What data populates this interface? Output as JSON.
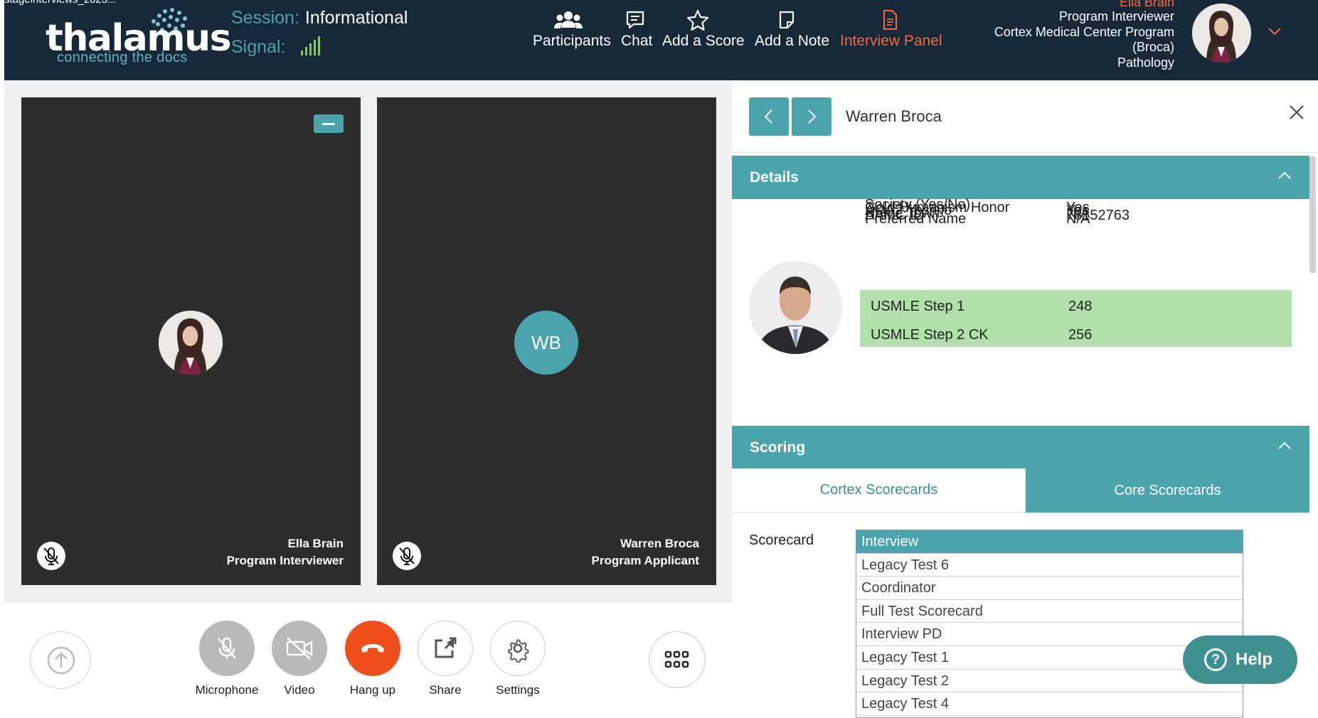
{
  "header": {
    "top_fragment": "stageinterviews_2023...",
    "logo": {
      "word": "thalamus",
      "tagline": "connecting the docs"
    },
    "session_label": "Session:",
    "session_value": "Informational",
    "signal_label": "Signal:",
    "signal_bars": 5,
    "nav": [
      {
        "label": "Participants",
        "icon": "participants-icon"
      },
      {
        "label": "Chat",
        "icon": "chat-icon"
      },
      {
        "label": "Add a Score",
        "icon": "star-icon"
      },
      {
        "label": "Add a Note",
        "icon": "note-icon"
      },
      {
        "label": "Interview Panel",
        "icon": "document-icon",
        "active": true
      }
    ],
    "user": {
      "name": "Ella Brain",
      "role": "Program Interviewer",
      "program_line1": "Cortex Medical Center Program",
      "program_line2": "(Broca)",
      "program_line3": "Pathology"
    }
  },
  "tiles": [
    {
      "name": "Ella Brain",
      "role": "Program Interviewer",
      "avatar": "photo"
    },
    {
      "name": "Warren Broca",
      "role": "Program Applicant",
      "initials": "WB"
    }
  ],
  "controls": [
    {
      "label": "Microphone",
      "icon": "mic-off-icon"
    },
    {
      "label": "Video",
      "icon": "video-off-icon"
    },
    {
      "label": "Hang up",
      "icon": "hangup-icon"
    },
    {
      "label": "Share",
      "icon": "share-icon"
    },
    {
      "label": "Settings",
      "icon": "gear-icon"
    }
  ],
  "panel": {
    "title": "Warren Broca",
    "details_header": "Details",
    "details": [
      {
        "key": "Preferred Name",
        "value": "N/A"
      },
      {
        "key": "AAMC ID",
        "value": "78152763"
      },
      {
        "key": "Home Town",
        "value": "N/A"
      },
      {
        "key": "AOA? Yes/No",
        "value": "Yes"
      },
      {
        "key": "Gold Humanism Honor",
        "value": "Yes"
      },
      {
        "key": "Society (Yes/No)",
        "value": ""
      }
    ],
    "highlights": [
      {
        "key": "USMLE Step 1",
        "value": "248"
      },
      {
        "key": "USMLE Step 2 CK",
        "value": "256"
      }
    ],
    "scoring_header": "Scoring",
    "tabs": [
      "Cortex Scorecards",
      "Core Scorecards"
    ],
    "scorecard_label": "Scorecard",
    "scorecards": [
      "Interview",
      "Legacy Test 6",
      "Coordinator",
      "Full Test Scorecard",
      "Interview PD",
      "Legacy Test 1",
      "Legacy Test 2",
      "Legacy Test 4"
    ]
  },
  "help_label": "Help",
  "colors": {
    "header_bg": "#172838",
    "teal": "#4aa3ad",
    "orange": "#f26a3b",
    "highlight_green": "#b2e0aa",
    "hangup_red": "#f04e1b"
  }
}
